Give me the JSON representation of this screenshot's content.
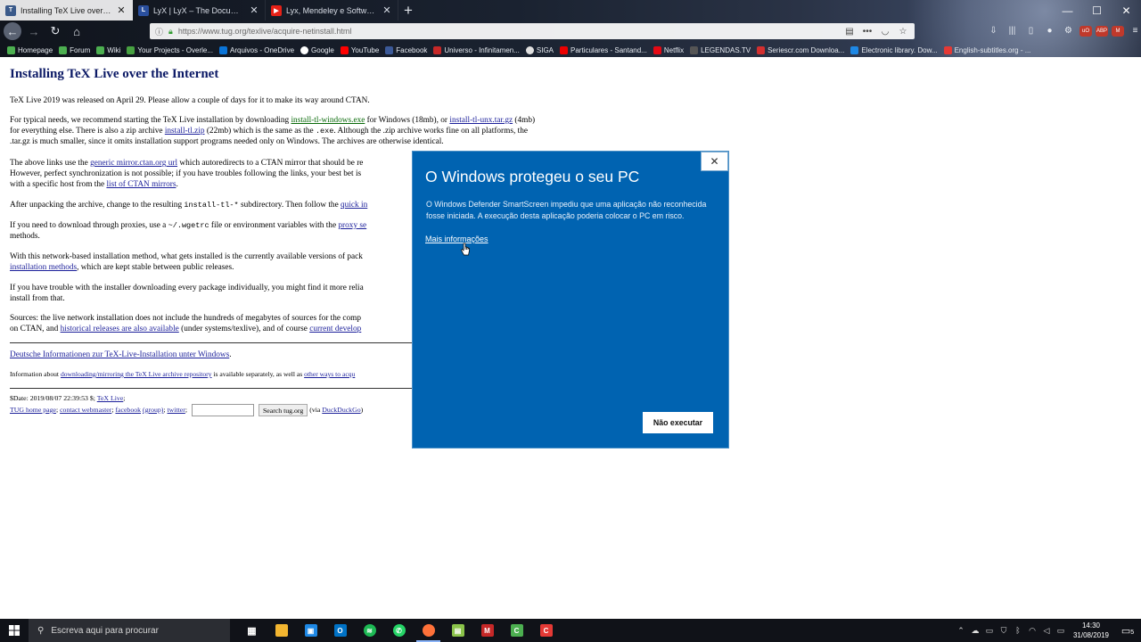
{
  "browser": {
    "tabs": [
      {
        "label": "Installing TeX Live over the Inte…",
        "icon": "tug-icon",
        "active": true
      },
      {
        "label": "LyX | LyX – The Document Proc…",
        "icon": "lyx-icon",
        "active": false
      },
      {
        "label": "Lyx, Mendeley e Softwares nec…",
        "icon": "youtube-icon",
        "active": false
      }
    ],
    "url": "https://www.tug.org/texlive/acquire-netinstall.html",
    "bookmarks": [
      {
        "label": "Homepage",
        "color": "#4caf50"
      },
      {
        "label": "Forum",
        "color": "#4caf50"
      },
      {
        "label": "Wiki",
        "color": "#4caf50"
      },
      {
        "label": "Your Projects - Overle...",
        "color": "#47a141"
      },
      {
        "label": "Arquivos - OneDrive",
        "color": "#0a74d8"
      },
      {
        "label": "Google",
        "color": "#ffffff"
      },
      {
        "label": "YouTube",
        "color": "#ff0000"
      },
      {
        "label": "Facebook",
        "color": "#3b5998"
      },
      {
        "label": "Universo - Infinitamen...",
        "color": "#c62828"
      },
      {
        "label": "SIGA",
        "color": "#e0e0e0"
      },
      {
        "label": "Particulares - Santand...",
        "color": "#ec0000"
      },
      {
        "label": "Netflix",
        "color": "#e50914"
      },
      {
        "label": "LEGENDAS.TV",
        "color": "#555555"
      },
      {
        "label": "Seriescr.com Downloa...",
        "color": "#d32f2f"
      },
      {
        "label": "Electronic library. Dow...",
        "color": "#1e88e5"
      },
      {
        "label": "English-subtitles.org - ...",
        "color": "#e53935"
      }
    ]
  },
  "page": {
    "title": "Installing TeX Live over the Internet",
    "p1": "TeX Live 2019 was released on April 29. Please allow a couple of days for it to make its way around CTAN.",
    "p2": {
      "a": "For typical needs, we recommend starting the TeX Live installation by downloading ",
      "link1": "install-tl-windows.exe",
      "b": " for Windows (18mb), or ",
      "link2": "install-tl-unx.tar.gz",
      "c": " (4mb)",
      "d": "for everything else. There is also a zip archive ",
      "link3": "install-tl.zip",
      "e": " (22mb) which is the same as the ",
      "code": ".exe",
      "f": ". Although the .zip archive works fine on all platforms, the",
      "g": ".tar.gz is much smaller, since it omits installation support programs needed only on Windows. The archives are otherwise identical."
    },
    "p3": {
      "a": "The above links use the ",
      "link1": "generic mirror.ctan.org url",
      "b": " which autoredirects to a CTAN mirror that should be re",
      "c": "However, perfect synchronization is not possible; if you have troubles following the links, your best bet is",
      "d": "with a specific host from the ",
      "link2": "list of CTAN mirrors",
      "e": "."
    },
    "p4": {
      "a": "After unpacking the archive, change to the resulting ",
      "code": "install-tl-*",
      "b": " subdirectory. Then follow the ",
      "link": "quick in"
    },
    "p5": {
      "a": "If you need to download through proxies, use a ",
      "code": "~/.wgetrc",
      "b": " file or environment variables with the ",
      "link": "proxy se",
      "c": "methods."
    },
    "p6": {
      "a": "With this network-based installation method, what gets installed is the currently available versions of pack",
      "link": "installation methods",
      "b": ", which are kept stable between public releases."
    },
    "p7": {
      "a": "If you have trouble with the installer downloading every package individually, you might find it more relia",
      "b": "install from that."
    },
    "p8": {
      "a": "Sources: the live network installation does not include the hundreds of megabytes of sources for the comp",
      "b": "on CTAN, and ",
      "link1": "historical releases are also available",
      "c": " (under systems/texlive), and of course ",
      "link2": "current develop"
    },
    "german_link": "Deutsche Informationen zur TeX-Live-Installation unter Windows",
    "info": {
      "a": "Information about ",
      "link1": "downloading/mirroring the TeX Live archive repository",
      "b": " is available separately, as well as ",
      "link2": "other ways to acqu"
    },
    "footer": {
      "date": "$Date: 2019/08/07 22:39:53 $; ",
      "texlive_link": "TeX Live",
      "links": [
        "TUG home page",
        "contact webmaster",
        "facebook",
        "(group)",
        "twitter"
      ],
      "search_button": "Search tug.org",
      "via": "(via ",
      "ddg": "DuckDuckGo",
      "via_end": ")"
    }
  },
  "dialog": {
    "title": "O Windows protegeu o seu PC",
    "body": "O Windows Defender SmartScreen impediu que uma aplicação não reconhecida fosse iniciada. A execução desta aplicação poderia colocar o PC em risco.",
    "more_info": "Mais informações",
    "dont_run": "Não executar",
    "close": "✕"
  },
  "taskbar": {
    "search_placeholder": "Escreva aqui para procurar",
    "time": "14:30",
    "date": "31/08/2019",
    "notification_count": "5",
    "apps": [
      {
        "name": "task-view",
        "color": "#101218",
        "glyph": "▦"
      },
      {
        "name": "file-explorer",
        "color": "#f2b530",
        "glyph": "▬"
      },
      {
        "name": "store",
        "color": "#1e88e5",
        "glyph": "▣"
      },
      {
        "name": "outlook",
        "color": "#0072c6",
        "glyph": "O"
      },
      {
        "name": "spotify",
        "color": "#1db954",
        "glyph": "≋"
      },
      {
        "name": "whatsapp",
        "color": "#25d366",
        "glyph": "✆"
      },
      {
        "name": "firefox",
        "color": "#ff7139",
        "glyph": "●"
      },
      {
        "name": "notepad",
        "color": "#8bc34a",
        "glyph": "▤"
      },
      {
        "name": "mendeley",
        "color": "#c62828",
        "glyph": "M"
      },
      {
        "name": "camtasia",
        "color": "#4caf50",
        "glyph": "C"
      },
      {
        "name": "camtasia-recorder",
        "color": "#e53935",
        "glyph": "C"
      }
    ]
  }
}
